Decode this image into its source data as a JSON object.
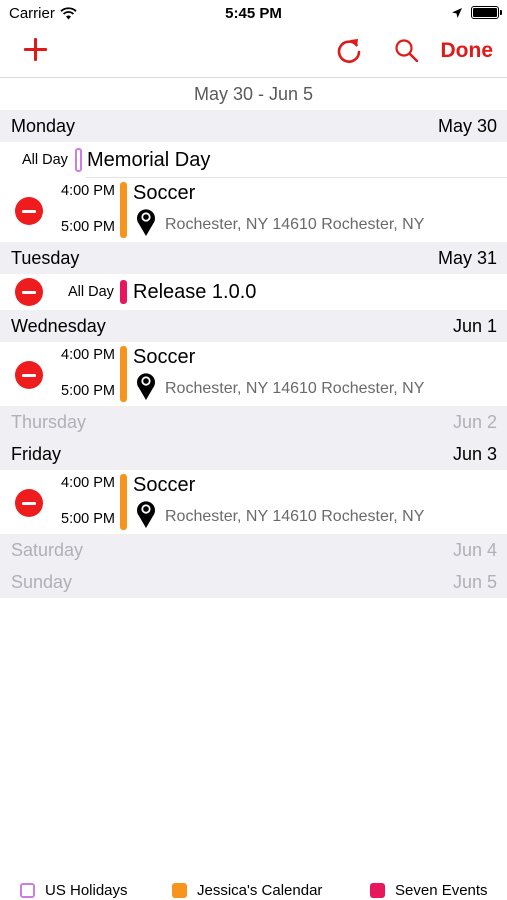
{
  "status_bar": {
    "carrier": "Carrier",
    "time": "5:45 PM",
    "icons": [
      "wifi-icon",
      "location-arrow-icon",
      "battery-icon"
    ]
  },
  "nav": {
    "add_icon": "plus-icon",
    "refresh_icon": "refresh-icon",
    "search_icon": "search-icon",
    "done_label": "Done",
    "accent_color": "#e01919"
  },
  "week_range": "May 30 - Jun 5",
  "days": {
    "monday": {
      "name": "Monday",
      "date": "May 30"
    },
    "tuesday": {
      "name": "Tuesday",
      "date": "May 31"
    },
    "wednesday": {
      "name": "Wednesday",
      "date": "Jun 1"
    },
    "thursday": {
      "name": "Thursday",
      "date": "Jun 2"
    },
    "friday": {
      "name": "Friday",
      "date": "Jun 3"
    },
    "saturday": {
      "name": "Saturday",
      "date": "Jun 4"
    },
    "sunday": {
      "name": "Sunday",
      "date": "Jun 5"
    }
  },
  "events": {
    "memorial_day": {
      "time_label": "All Day",
      "title": "Memorial Day",
      "calendar": "US Holidays"
    },
    "monday_soccer": {
      "start": "4:00 PM",
      "end": "5:00 PM",
      "title": "Soccer",
      "location": "Rochester, NY  14610 Rochester, NY",
      "calendar": "Jessica's Calendar"
    },
    "release": {
      "time_label": "All Day",
      "title": "Release 1.0.0",
      "calendar": "Seven Events"
    },
    "wednesday_soccer": {
      "start": "4:00 PM",
      "end": "5:00 PM",
      "title": "Soccer",
      "location": "Rochester, NY  14610 Rochester, NY",
      "calendar": "Jessica's Calendar"
    },
    "friday_soccer": {
      "start": "4:00 PM",
      "end": "5:00 PM",
      "title": "Soccer",
      "location": "Rochester, NY  14610 Rochester, NY",
      "calendar": "Jessica's Calendar"
    }
  },
  "legend": [
    {
      "label": "US Holidays",
      "color": "#c97ee0",
      "style": "hollow"
    },
    {
      "label": "Jessica's Calendar",
      "color": "#f7941d",
      "style": "filled"
    },
    {
      "label": "Seven Events",
      "color": "#e8175d",
      "style": "filled"
    }
  ],
  "colors": {
    "us_holidays": "#c97ee0",
    "jessicas_calendar": "#f7941d",
    "seven_events": "#e8175d",
    "delete": "#ee1c1c",
    "section_bg": "#efeff4"
  }
}
